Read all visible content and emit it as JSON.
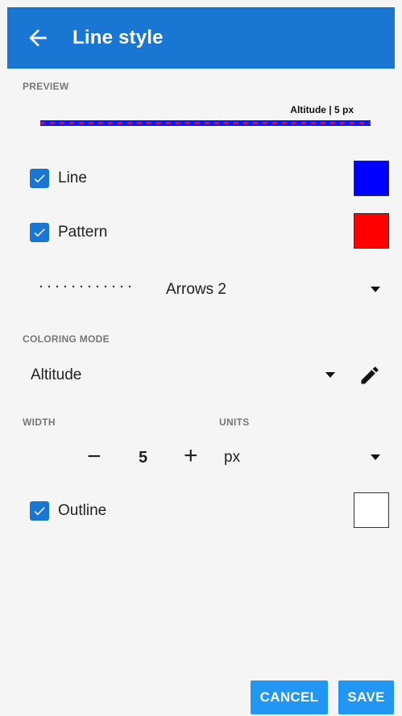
{
  "appbar": {
    "title": "Line style",
    "back_icon": "arrow-left-icon"
  },
  "preview": {
    "label": "PREVIEW",
    "caption": "Altitude | 5 px"
  },
  "line": {
    "label": "Line",
    "checked": true,
    "color": "#0000ff"
  },
  "pattern": {
    "label": "Pattern",
    "checked": true,
    "color": "#ff0000"
  },
  "pattern_style": {
    "value": "Arrows 2"
  },
  "coloring": {
    "label": "COLORING MODE",
    "value": "Altitude",
    "edit_icon": "pencil-icon"
  },
  "width": {
    "label": "WIDTH",
    "value": "5",
    "minus": "−",
    "plus": "+"
  },
  "units": {
    "label": "UNITS",
    "value": "px"
  },
  "outline": {
    "label": "Outline",
    "checked": true,
    "color": "#ffffff"
  },
  "actions": {
    "cancel": "CANCEL",
    "save": "SAVE"
  }
}
